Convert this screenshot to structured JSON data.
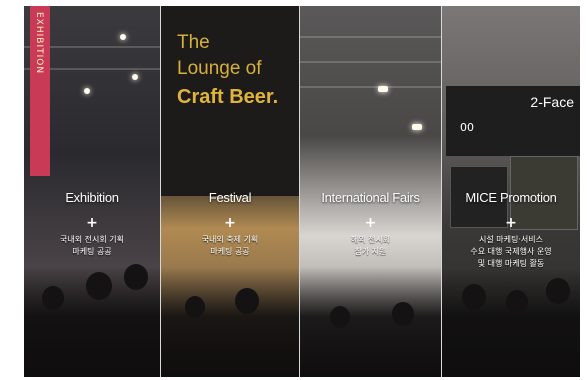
{
  "panels": [
    {
      "title": "Exhibition",
      "plus": "+",
      "desc_line1": "국내외 전시회 기획",
      "desc_line2": "마케팅 공공"
    },
    {
      "title": "Festival",
      "plus": "+",
      "desc_line1": "국내외 축제 기획",
      "desc_line2": "마케팅 공공"
    },
    {
      "title": "International Fairs",
      "plus": "+",
      "desc_line1": "해외 전시회",
      "desc_line2": "참가 지원"
    },
    {
      "title": "MICE Promotion",
      "plus": "+",
      "desc_line1": "시설 마케팅·서비스",
      "desc_line2": "수요 대행 국제행사 운영",
      "desc_line3": "및 대행 마케팅 활동"
    }
  ],
  "festival_sign": {
    "line1": "The",
    "line2": "Lounge of",
    "line3": "Craft Beer."
  },
  "mice_board": {
    "text": "2-Face",
    "sub": "00"
  },
  "colors": {
    "banner": "#c83a56",
    "sign_text": "#d6b03a",
    "divider": "#d8d8d8"
  }
}
